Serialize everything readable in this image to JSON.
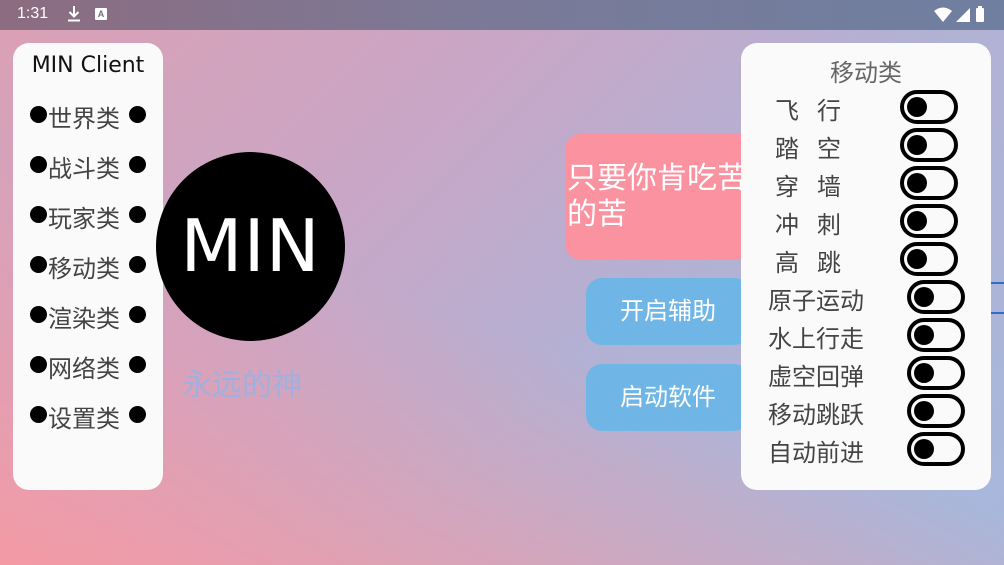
{
  "status_bar": {
    "time": "1:31",
    "download_icon": "download-icon",
    "a_badge": "A"
  },
  "left_panel": {
    "title": "MIN Client",
    "items": [
      {
        "label": "世界类"
      },
      {
        "label": "战斗类"
      },
      {
        "label": "玩家类"
      },
      {
        "label": "移动类"
      },
      {
        "label": "渲染类"
      },
      {
        "label": "网络类"
      },
      {
        "label": "设置类"
      }
    ]
  },
  "logo": {
    "text": "MIN"
  },
  "tagline": "永远的神",
  "quote": {
    "line1": "只要你肯吃苦",
    "line2": "的苦"
  },
  "buttons": {
    "enable_assist": "开启辅助",
    "start_software": "启动软件"
  },
  "right_panel": {
    "title": "移动类",
    "modules": [
      {
        "label": "飞行",
        "enabled": false
      },
      {
        "label": "踏空",
        "enabled": false
      },
      {
        "label": "穿墙",
        "enabled": false
      },
      {
        "label": "冲刺",
        "enabled": false
      },
      {
        "label": "高跳",
        "enabled": false
      },
      {
        "label": "原子运动",
        "enabled": false
      },
      {
        "label": "水上行走",
        "enabled": false
      },
      {
        "label": "虚空回弹",
        "enabled": false
      },
      {
        "label": "移动跳跃",
        "enabled": false
      },
      {
        "label": "自动前进",
        "enabled": false
      }
    ]
  },
  "colors": {
    "quote_bg": "#fb92a0",
    "button_bg": "#6fb6e6",
    "tagline": "#9fb0e0",
    "panel_bg": "#fafafa"
  }
}
